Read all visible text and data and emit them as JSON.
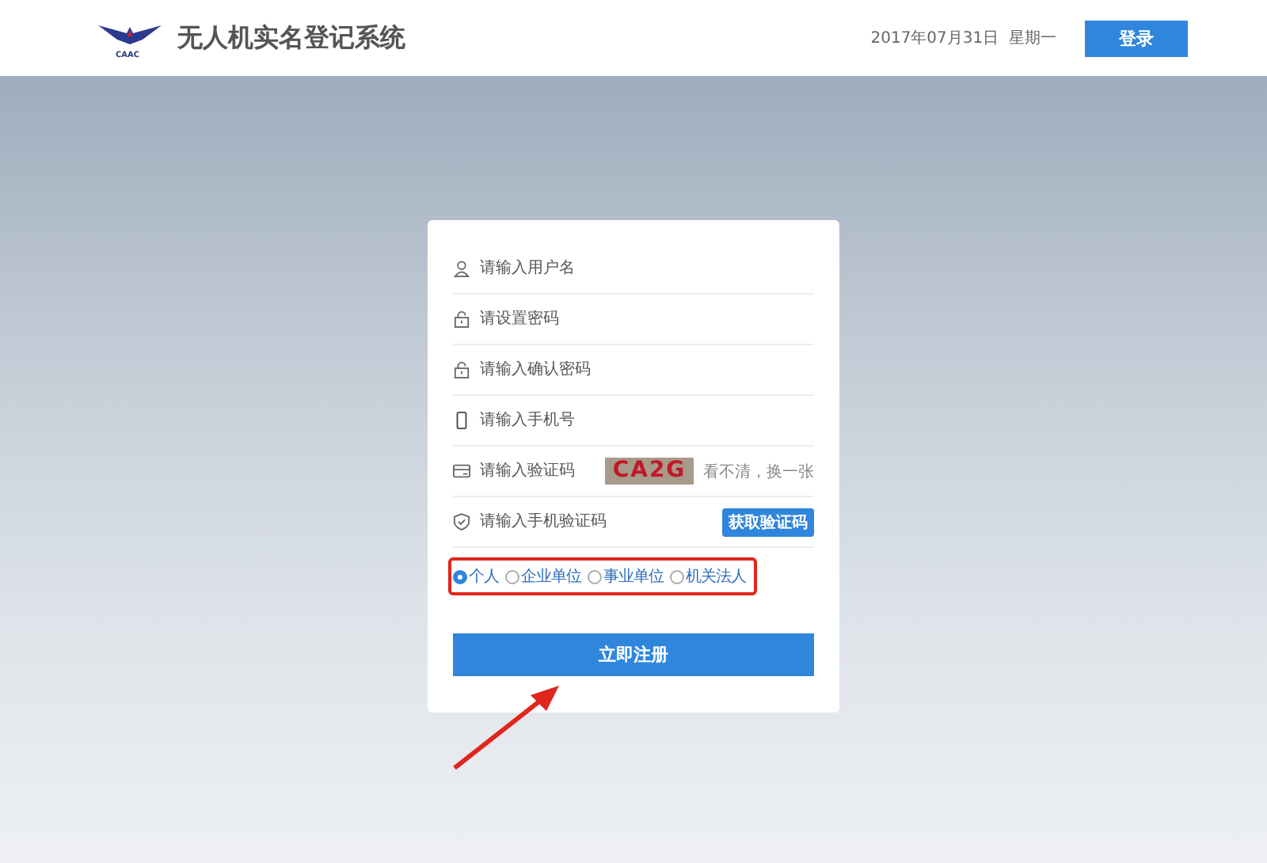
{
  "header": {
    "logo_text": "CAAC",
    "title": "无人机实名登记系统",
    "date": "2017年07月31日  星期一",
    "login_button": "登录"
  },
  "form": {
    "fields": [
      {
        "kind": "user",
        "placeholder": "请输入用户名"
      },
      {
        "kind": "lock",
        "placeholder": "请设置密码"
      },
      {
        "kind": "lock",
        "placeholder": "请输入确认密码"
      },
      {
        "kind": "phone",
        "placeholder": "请输入手机号"
      },
      {
        "kind": "captcha",
        "placeholder": "请输入验证码",
        "captcha": "CA2G",
        "refresh_link": "看不清，换一张"
      },
      {
        "kind": "sms",
        "placeholder": "请输入手机验证码",
        "button": "获取验证码"
      }
    ],
    "user_types": [
      {
        "label": "个人",
        "selected": true
      },
      {
        "label": "企业单位",
        "selected": false
      },
      {
        "label": "事业单位",
        "selected": false
      },
      {
        "label": "机关法人",
        "selected": false
      }
    ],
    "submit": "立即注册"
  },
  "annotations": {
    "highlight_box": true,
    "arrow": true
  }
}
